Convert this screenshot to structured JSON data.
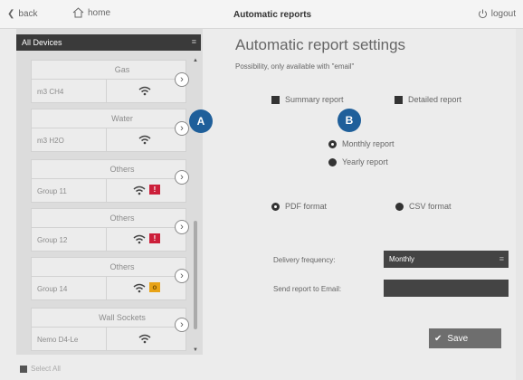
{
  "topbar": {
    "back_label": "back",
    "home_label": "home",
    "title": "Automatic reports",
    "logout_label": "logout"
  },
  "devices": {
    "header": "All Devices",
    "items": [
      {
        "category": "Gas",
        "name": "m3 CH4",
        "badge": "",
        "badge_color": ""
      },
      {
        "category": "Water",
        "name": "m3 H2O",
        "badge": "",
        "badge_color": ""
      },
      {
        "category": "Others",
        "name": "Group 11",
        "badge": "!",
        "badge_color": "#cc1f3a"
      },
      {
        "category": "Others",
        "name": "Group 12",
        "badge": "!",
        "badge_color": "#cc1f3a"
      },
      {
        "category": "Others",
        "name": "Group 14",
        "badge": "o",
        "badge_color": "#e8a317"
      },
      {
        "category": "Wall Sockets",
        "name": "Nemo D4-Le",
        "badge": "",
        "badge_color": ""
      }
    ],
    "select_all_label": "Select All"
  },
  "settings": {
    "title": "Automatic report settings",
    "subtitle": "Possibility, only available with \"email\"",
    "summary_label": "Summary report",
    "detailed_label": "Detailed report",
    "monthly_label": "Monthly report",
    "yearly_label": "Yearly report",
    "pdf_label": "PDF format",
    "csv_label": "CSV format",
    "delivery_label": "Delivery frequency:",
    "delivery_value": "Monthly",
    "email_label": "Send report to Email:",
    "email_value": "",
    "save_label": "Save"
  },
  "callouts": {
    "a": "A",
    "b": "B"
  }
}
